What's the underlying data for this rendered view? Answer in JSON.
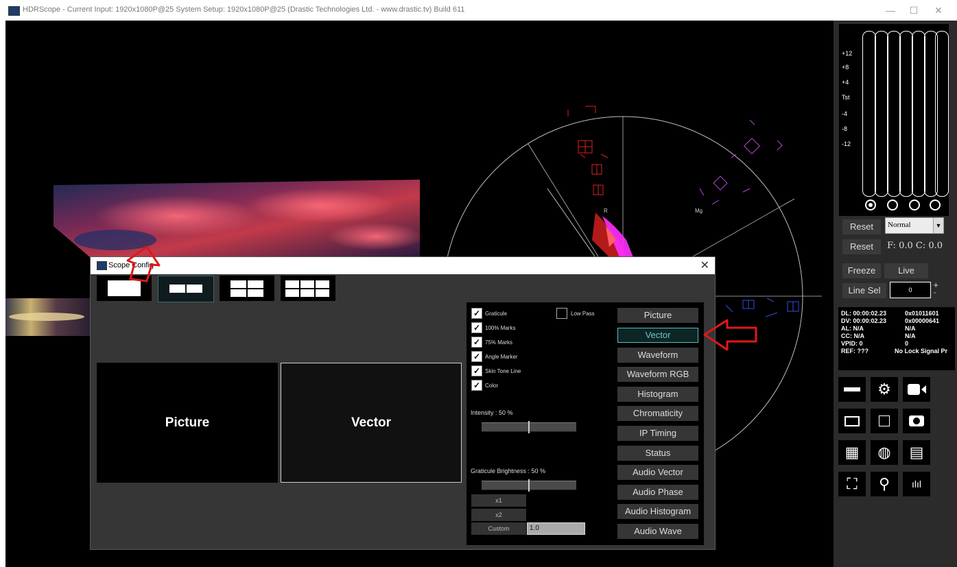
{
  "window": {
    "title": "HDRScope -  Current Input: 1920x1080P@25  System Setup: 1920x1080P@25   (Drastic Technologies Ltd. - www.drastic.tv) Build 611",
    "minimize": "—",
    "maximize": "☐",
    "close": "✕"
  },
  "vectorscope": {
    "label_r": "R",
    "label_mg": "Mg"
  },
  "audio_meter": {
    "scale": [
      "+12",
      "+8",
      "+4",
      "Tst",
      "-4",
      "-8",
      "-12"
    ]
  },
  "right_panel": {
    "reset1": "Reset",
    "mode_value": "Normal",
    "reset2": "Reset",
    "fc_readout": "F: 0.0  C: 0.0",
    "freeze": "Freeze",
    "live": "Live",
    "line_sel": "Line Sel",
    "line_value": "0",
    "plus": "+",
    "minus": "-"
  },
  "status": {
    "rows": [
      {
        "label": "DL:  00:00:02.23",
        "value": "0x01011601"
      },
      {
        "label": "DV:  00:00:02.23",
        "value": "0x00000641"
      },
      {
        "label": "AL:  N/A",
        "value": "N/A"
      },
      {
        "label": "CC:  N/A",
        "value": "N/A"
      },
      {
        "label": "VPID:    0",
        "value": "0"
      },
      {
        "label": "REF:     ???",
        "value": "No Lock Signal Pr"
      }
    ]
  },
  "icons": [
    "layout-icon",
    "gear-icon",
    "cast-icon",
    "monitor-icon",
    "window-icon",
    "camera-icon",
    "table-icon",
    "globe-icon",
    "calendar-icon",
    "fullscreen-icon",
    "search-icon",
    "audio-icon"
  ],
  "dialog": {
    "title": "Scope Config",
    "close": "✕",
    "preview_left": "Picture",
    "preview_right": "Vector",
    "options": {
      "graticule": "Graticule",
      "low_pass": "Low Pass",
      "marks100": "100% Marks",
      "marks75": "75% Marks",
      "angle_marker": "Angle Marker",
      "skin_tone": "Skin Tone Line",
      "color": "Color",
      "check": "✓",
      "intensity_label": "Intensity : 50 %",
      "intensity": 0.5,
      "graticule_brightness_label": "Graticule Brightness : 50 %",
      "graticule_brightness": 0.5,
      "x1": "x1",
      "x2": "x2",
      "custom": "Custom",
      "custom_value": "1.0"
    },
    "scopes": [
      "Picture",
      "Vector",
      "Waveform",
      "Waveform RGB",
      "Histogram",
      "Chromaticity",
      "IP Timing",
      "Status",
      "Audio Vector",
      "Audio Phase",
      "Audio Histogram",
      "Audio Wave"
    ],
    "active_scope": "Vector"
  },
  "colors": {
    "accent": "#55c0c0",
    "annotation_arrow": "#e01818",
    "trace_red": "#e02020",
    "trace_magenta": "#ff30ff"
  }
}
